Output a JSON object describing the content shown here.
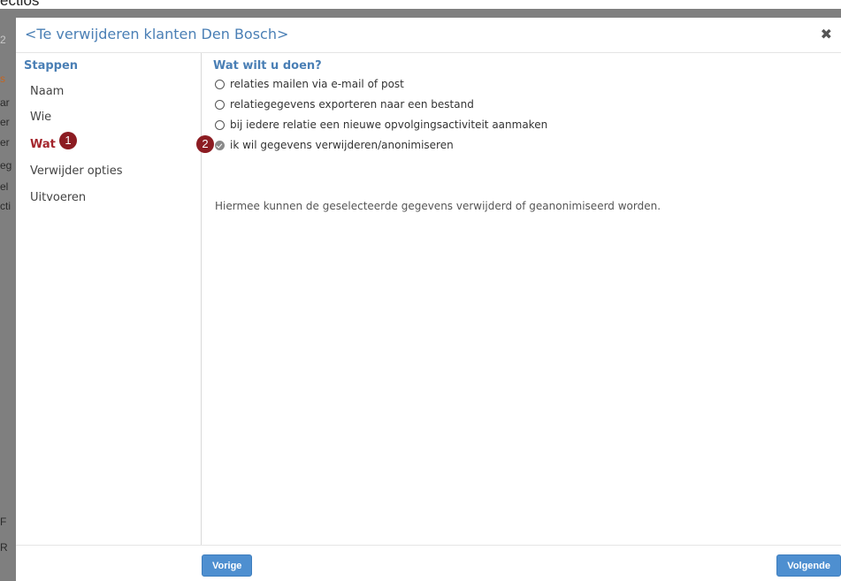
{
  "background": {
    "top_text": "ectios",
    "fragments": [
      "2",
      "s",
      "ar",
      "er",
      "er",
      "eg",
      "el",
      "cti",
      "F",
      "R"
    ]
  },
  "modal": {
    "title": "<Te verwijderen klanten Den Bosch>",
    "close_glyph": "✖"
  },
  "sidebar": {
    "heading": "Stappen",
    "steps": [
      {
        "label": "Naam",
        "active": false
      },
      {
        "label": "Wie",
        "active": false
      },
      {
        "label": "Wat",
        "active": true
      },
      {
        "label": "Verwijder opties",
        "active": false
      },
      {
        "label": "Uitvoeren",
        "active": false
      }
    ],
    "badge_wat": "1"
  },
  "main": {
    "heading": "Wat wilt u doen?",
    "options": [
      {
        "label": "relaties mailen via e-mail of post",
        "checked": false
      },
      {
        "label": "relatiegegevens exporteren naar een bestand",
        "checked": false
      },
      {
        "label": "bij iedere relatie een nieuwe opvolgingsactiviteit aanmaken",
        "checked": false
      },
      {
        "label": "ik wil gegevens verwijderen/anonimiseren",
        "checked": true
      }
    ],
    "badge_option": "2",
    "description": "Hiermee kunnen de geselecteerde gegevens verwijderd of geanonimiseerd worden."
  },
  "footer": {
    "prev_label": "Vorige",
    "next_label": "Volgende"
  },
  "colors": {
    "accent": "#4a7fb5",
    "active_step": "#a4252c",
    "badge": "#8c1c22",
    "button": "#4e8fd0"
  }
}
